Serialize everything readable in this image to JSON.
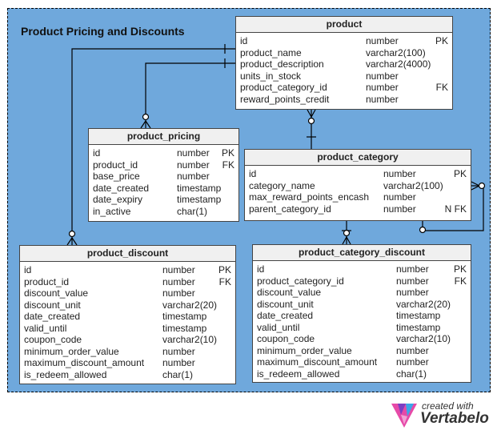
{
  "diagram": {
    "title": "Product Pricing and Discounts",
    "tables": {
      "product": {
        "name": "product",
        "columns": [
          {
            "name": "id",
            "type": "number",
            "key": "PK"
          },
          {
            "name": "product_name",
            "type": "varchar2(100)",
            "key": ""
          },
          {
            "name": "product_description",
            "type": "varchar2(4000)",
            "key": ""
          },
          {
            "name": "units_in_stock",
            "type": "number",
            "key": ""
          },
          {
            "name": "product_category_id",
            "type": "number",
            "key": "FK"
          },
          {
            "name": "reward_points_credit",
            "type": "number",
            "key": ""
          }
        ]
      },
      "product_pricing": {
        "name": "product_pricing",
        "columns": [
          {
            "name": "id",
            "type": "number",
            "key": "PK"
          },
          {
            "name": "product_id",
            "type": "number",
            "key": "FK"
          },
          {
            "name": "base_price",
            "type": "number",
            "key": ""
          },
          {
            "name": "date_created",
            "type": "timestamp",
            "key": ""
          },
          {
            "name": "date_expiry",
            "type": "timestamp",
            "key": ""
          },
          {
            "name": "in_active",
            "type": "char(1)",
            "key": ""
          }
        ]
      },
      "product_category": {
        "name": "product_category",
        "columns": [
          {
            "name": "id",
            "type": "number",
            "key": "PK"
          },
          {
            "name": "category_name",
            "type": "varchar2(100)",
            "key": ""
          },
          {
            "name": "max_reward_points_encash",
            "type": "number",
            "key": ""
          },
          {
            "name": "parent_category_id",
            "type": "number",
            "key": "N FK"
          }
        ]
      },
      "product_discount": {
        "name": "product_discount",
        "columns": [
          {
            "name": "id",
            "type": "number",
            "key": "PK"
          },
          {
            "name": "product_id",
            "type": "number",
            "key": "FK"
          },
          {
            "name": "discount_value",
            "type": "number",
            "key": ""
          },
          {
            "name": "discount_unit",
            "type": "varchar2(20)",
            "key": ""
          },
          {
            "name": "date_created",
            "type": "timestamp",
            "key": ""
          },
          {
            "name": "valid_until",
            "type": "timestamp",
            "key": ""
          },
          {
            "name": "coupon_code",
            "type": "varchar2(10)",
            "key": ""
          },
          {
            "name": "minimum_order_value",
            "type": "number",
            "key": ""
          },
          {
            "name": "maximum_discount_amount",
            "type": "number",
            "key": ""
          },
          {
            "name": "is_redeem_allowed",
            "type": "char(1)",
            "key": ""
          }
        ]
      },
      "product_category_discount": {
        "name": "product_category_discount",
        "columns": [
          {
            "name": "id",
            "type": "number",
            "key": "PK"
          },
          {
            "name": "product_category_id",
            "type": "number",
            "key": "FK"
          },
          {
            "name": "discount_value",
            "type": "number",
            "key": ""
          },
          {
            "name": "discount_unit",
            "type": "varchar2(20)",
            "key": ""
          },
          {
            "name": "date_created",
            "type": "timestamp",
            "key": ""
          },
          {
            "name": "valid_until",
            "type": "timestamp",
            "key": ""
          },
          {
            "name": "coupon_code",
            "type": "varchar2(10)",
            "key": ""
          },
          {
            "name": "minimum_order_value",
            "type": "number",
            "key": ""
          },
          {
            "name": "maximum_discount_amount",
            "type": "number",
            "key": ""
          },
          {
            "name": "is_redeem_allowed",
            "type": "char(1)",
            "key": ""
          }
        ]
      }
    },
    "relationships": [
      {
        "from": "product",
        "to": "product_discount",
        "type": "one-to-zero-or-many"
      },
      {
        "from": "product",
        "to": "product_pricing",
        "type": "one-to-zero-or-many"
      },
      {
        "from": "product_category",
        "to": "product",
        "type": "one-to-zero-or-many"
      },
      {
        "from": "product_category",
        "to": "product_category_discount",
        "type": "one-to-zero-or-many"
      },
      {
        "from": "product_category",
        "to": "product_category",
        "type": "zero-or-one-to-zero-or-many"
      }
    ],
    "colors": {
      "canvas": "#6fa8dc",
      "table_header": "#f0f0f0",
      "border": "#444444"
    }
  },
  "branding": {
    "line1": "created with",
    "line2": "Vertabelo",
    "icon": "vertabelo-logo-icon"
  }
}
